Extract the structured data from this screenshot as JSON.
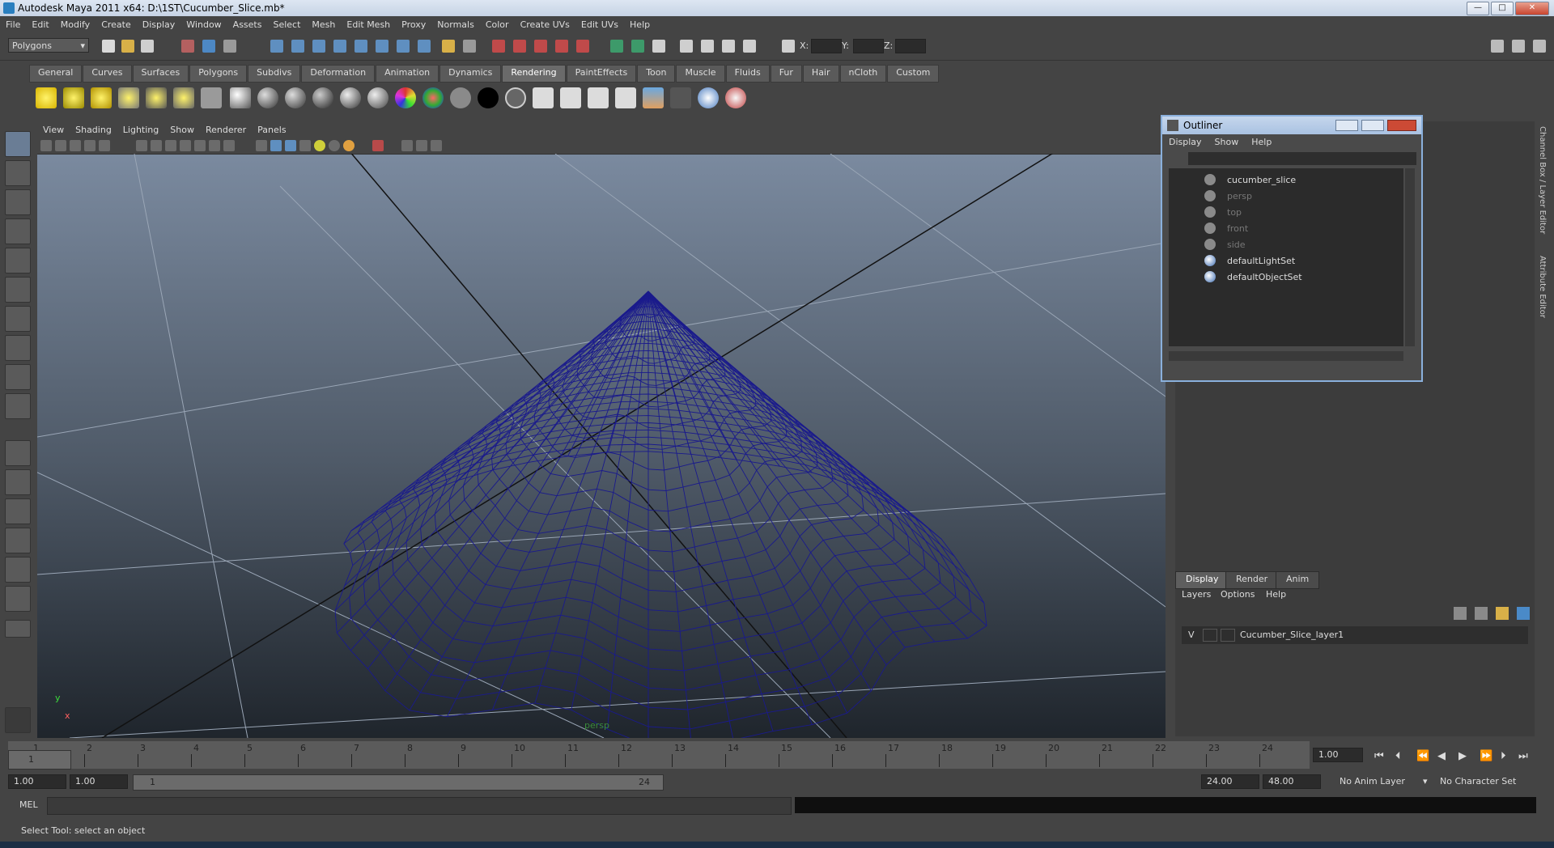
{
  "window": {
    "title": "Autodesk Maya 2011 x64: D:\\1ST\\Cucumber_Slice.mb*",
    "min_label": "—",
    "max_label": "□",
    "close_label": "✕"
  },
  "menubar": [
    "File",
    "Edit",
    "Modify",
    "Create",
    "Display",
    "Window",
    "Assets",
    "Select",
    "Mesh",
    "Edit Mesh",
    "Proxy",
    "Normals",
    "Color",
    "Create UVs",
    "Edit UVs",
    "Help"
  ],
  "statusline": {
    "mode": "Polygons",
    "x_label": "X:",
    "y_label": "Y:",
    "z_label": "Z:"
  },
  "shelf_tabs": [
    "General",
    "Curves",
    "Surfaces",
    "Polygons",
    "Subdivs",
    "Deformation",
    "Animation",
    "Dynamics",
    "Rendering",
    "PaintEffects",
    "Toon",
    "Muscle",
    "Fluids",
    "Fur",
    "Hair",
    "nCloth",
    "Custom"
  ],
  "shelf_active": "Rendering",
  "viewport": {
    "menu": [
      "View",
      "Shading",
      "Lighting",
      "Show",
      "Renderer",
      "Panels"
    ],
    "camera_label": "persp",
    "axis_y": "y",
    "axis_x": "x",
    "wire_color": "#1a1a8c"
  },
  "outliner": {
    "title": "Outliner",
    "menu": [
      "Display",
      "Show",
      "Help"
    ],
    "items": [
      {
        "label": "cucumber_slice",
        "icon": "mesh-transform-icon",
        "dim": false
      },
      {
        "label": "persp",
        "icon": "camera-icon",
        "dim": true
      },
      {
        "label": "top",
        "icon": "camera-icon",
        "dim": true
      },
      {
        "label": "front",
        "icon": "camera-icon",
        "dim": true
      },
      {
        "label": "side",
        "icon": "camera-icon",
        "dim": true
      },
      {
        "label": "defaultLightSet",
        "icon": "set-icon",
        "dim": false
      },
      {
        "label": "defaultObjectSet",
        "icon": "set-icon",
        "dim": false
      }
    ]
  },
  "right_tabs": [
    "Channel Box / Layer Editor",
    "Attribute Editor"
  ],
  "layer_editor": {
    "tabs": [
      "Display",
      "Render",
      "Anim"
    ],
    "active_tab": "Display",
    "menu": [
      "Layers",
      "Options",
      "Help"
    ],
    "layer": {
      "visible": "V",
      "name": "Cucumber_Slice_layer1"
    }
  },
  "timeline": {
    "ticks": [
      "1",
      "2",
      "3",
      "4",
      "5",
      "6",
      "7",
      "8",
      "9",
      "10",
      "11",
      "12",
      "13",
      "14",
      "15",
      "16",
      "17",
      "18",
      "19",
      "20",
      "21",
      "22",
      "23",
      "24"
    ],
    "current_frame": "1.00",
    "current_marker": "1"
  },
  "range": {
    "start": "1.00",
    "playback_start": "1.00",
    "slider_start": "1",
    "slider_end": "24",
    "playback_end": "24.00",
    "end": "48.00",
    "anim_layer": "No Anim Layer",
    "character_set": "No Character Set"
  },
  "command": {
    "label": "MEL",
    "help": "Select Tool: select an object"
  }
}
